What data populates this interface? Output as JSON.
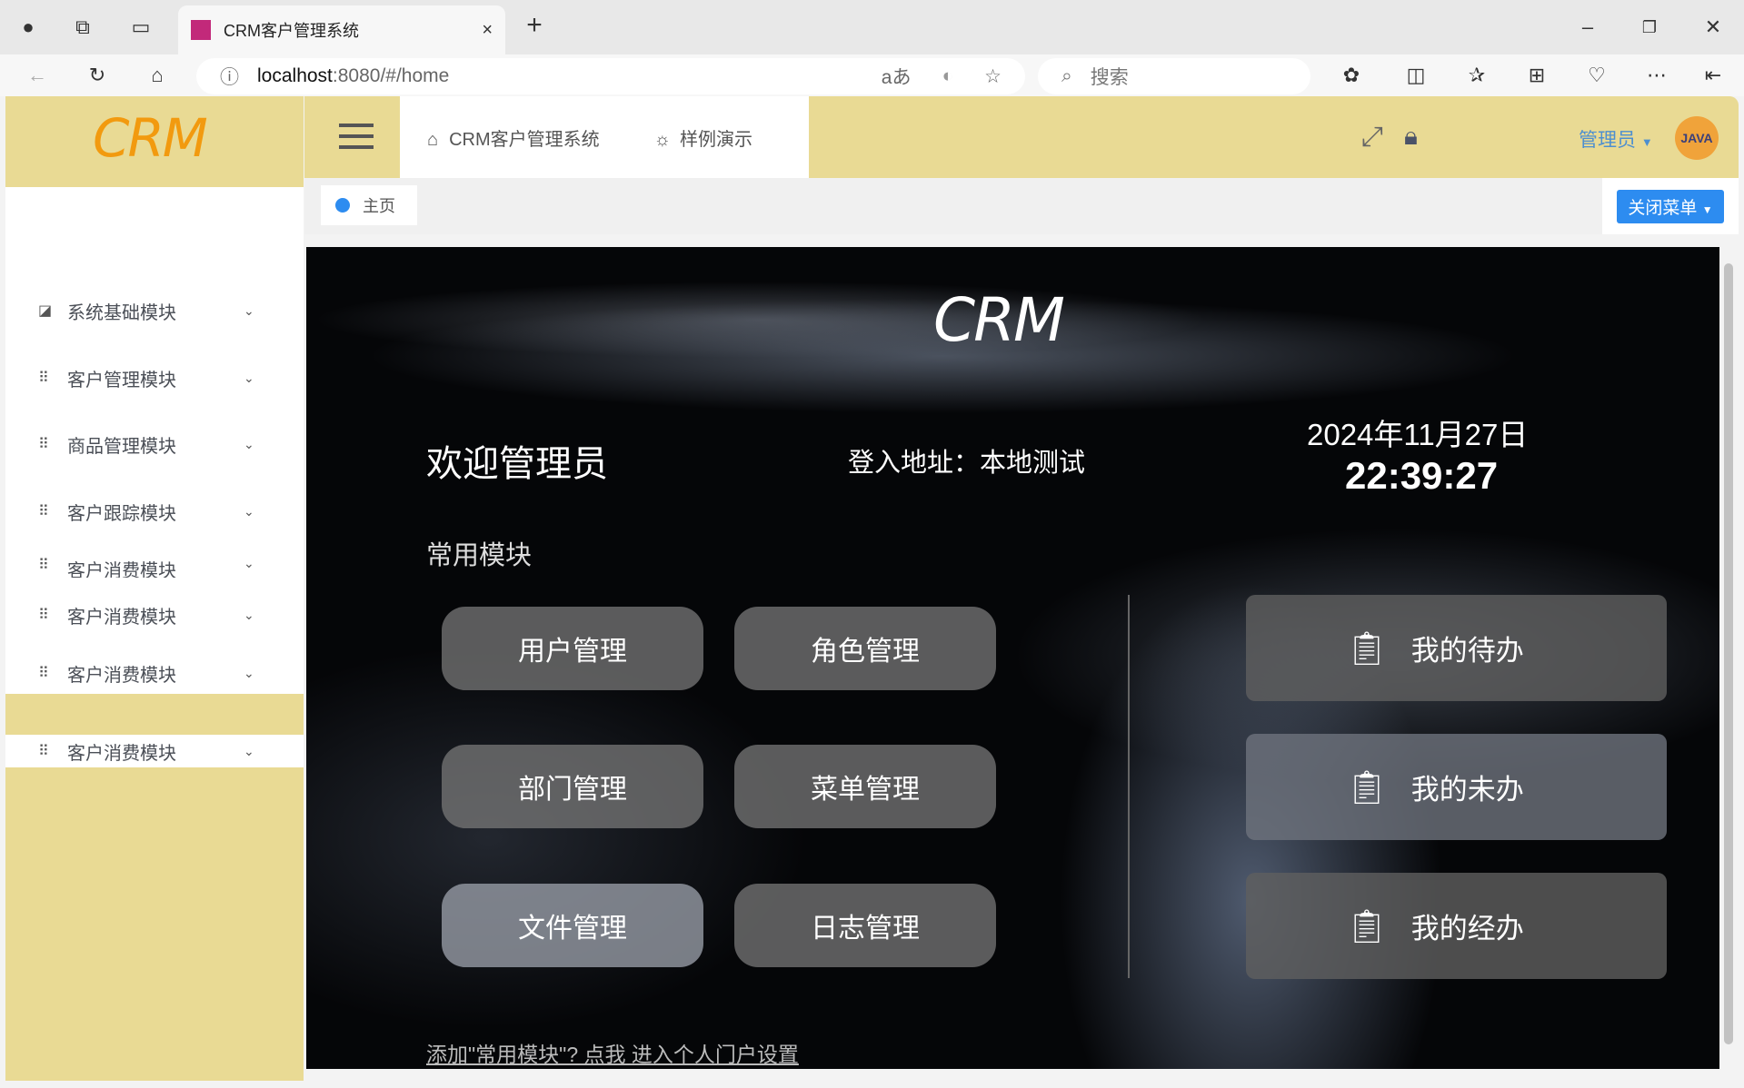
{
  "browser": {
    "tab_title": "CRM客户管理系统",
    "url_host": "localhost",
    "url_rest": ":8080/#/home",
    "search_placeholder": "搜索"
  },
  "sidebar": {
    "logo": "CRM",
    "items": [
      {
        "label": "系统基础模块",
        "icon": "chart-icon"
      },
      {
        "label": "客户管理模块",
        "icon": "grid-icon"
      },
      {
        "label": "商品管理模块",
        "icon": "grid-icon"
      },
      {
        "label": "客户跟踪模块",
        "icon": "grid-icon"
      },
      {
        "label": "客户消费模块",
        "icon": "grid-icon"
      },
      {
        "label": "客户消费模块",
        "icon": "grid-icon"
      },
      {
        "label": "客户消费模块",
        "icon": "grid-icon"
      },
      {
        "label": "客户消费模块",
        "icon": "grid-icon"
      }
    ]
  },
  "header": {
    "breadcrumb_home": "CRM客户管理系统",
    "breadcrumb_demo": "样例演示",
    "user": "管理员",
    "avatar_text": "JAVA"
  },
  "tags": {
    "home": "主页",
    "close_menu": "关闭菜单"
  },
  "main": {
    "logo": "CRM",
    "welcome": "欢迎管理员",
    "login_addr": "登入地址：本地测试",
    "date": "2024年11月27日",
    "time": "22:39:27",
    "common_title": "常用模块",
    "modules": [
      "用户管理",
      "角色管理",
      "部门管理",
      "菜单管理",
      "文件管理",
      "日志管理"
    ],
    "cards": [
      {
        "label": "我的待办",
        "icon": "todo-clock-icon"
      },
      {
        "label": "我的未办",
        "icon": "todo-check-icon"
      },
      {
        "label": "我的经办",
        "icon": "todo-done-icon"
      }
    ],
    "link": "添加\"常用模块\"? 点我 进入个人门户设置"
  }
}
